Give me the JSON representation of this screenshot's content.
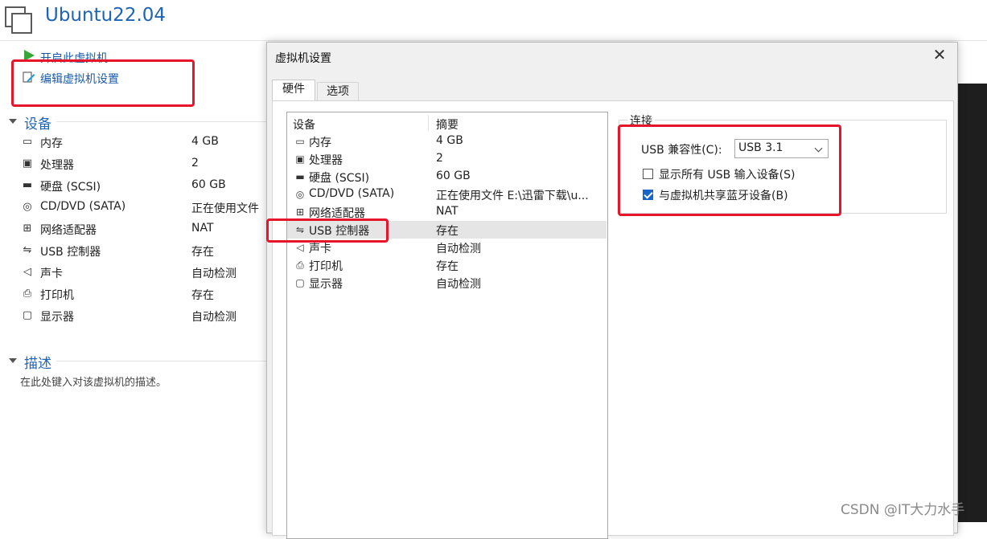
{
  "app": {
    "vm_name": "Ubuntu22.04"
  },
  "actions": {
    "power_on": "开启此虚拟机",
    "edit_settings": "编辑虚拟机设置"
  },
  "devices_section": {
    "title": "设备",
    "items": [
      {
        "icon": "memory-icon",
        "name": "内存",
        "value": "4 GB"
      },
      {
        "icon": "processor-icon",
        "name": "处理器",
        "value": "2"
      },
      {
        "icon": "disk-icon",
        "name": "硬盘 (SCSI)",
        "value": "60 GB"
      },
      {
        "icon": "cd-icon",
        "name": "CD/DVD (SATA)",
        "value": "正在使用文件"
      },
      {
        "icon": "network-icon",
        "name": "网络适配器",
        "value": "NAT"
      },
      {
        "icon": "usb-icon",
        "name": "USB 控制器",
        "value": "存在"
      },
      {
        "icon": "sound-icon",
        "name": "声卡",
        "value": "自动检测"
      },
      {
        "icon": "printer-icon",
        "name": "打印机",
        "value": "存在"
      },
      {
        "icon": "display-icon",
        "name": "显示器",
        "value": "自动检测"
      }
    ]
  },
  "description_section": {
    "title": "描述",
    "placeholder": "在此处键入对该虚拟机的描述。"
  },
  "dialog": {
    "title": "虚拟机设置",
    "close_glyph": "✕",
    "tabs": [
      "硬件",
      "选项"
    ],
    "list_headers": {
      "device": "设备",
      "summary": "摘要"
    },
    "devices": [
      {
        "icon": "memory-icon",
        "name": "内存",
        "summary": "4 GB"
      },
      {
        "icon": "processor-icon",
        "name": "处理器",
        "summary": "2"
      },
      {
        "icon": "disk-icon",
        "name": "硬盘 (SCSI)",
        "summary": "60 GB"
      },
      {
        "icon": "cd-icon",
        "name": "CD/DVD (SATA)",
        "summary": "正在使用文件 E:\\迅雷下载\\u..."
      },
      {
        "icon": "network-icon",
        "name": "网络适配器",
        "summary": "NAT"
      },
      {
        "icon": "usb-icon",
        "name": "USB 控制器",
        "summary": "存在",
        "selected": true
      },
      {
        "icon": "sound-icon",
        "name": "声卡",
        "summary": "自动检测"
      },
      {
        "icon": "printer-icon",
        "name": "打印机",
        "summary": "存在"
      },
      {
        "icon": "display-icon",
        "name": "显示器",
        "summary": "自动检测"
      }
    ],
    "connection": {
      "title": "连接",
      "compat_label": "USB 兼容性(C):",
      "compat_value": "USB 3.1",
      "show_all_label": "显示所有 USB 输入设备(S)",
      "show_all_checked": false,
      "share_bt_label": "与虚拟机共享蓝牙设备(B)",
      "share_bt_checked": true
    }
  },
  "watermark": "CSDN @IT大力水手",
  "colors": {
    "accent": "#1e64b4",
    "highlight_red": "#e8142a",
    "checkbox_blue": "#1a64c8"
  }
}
